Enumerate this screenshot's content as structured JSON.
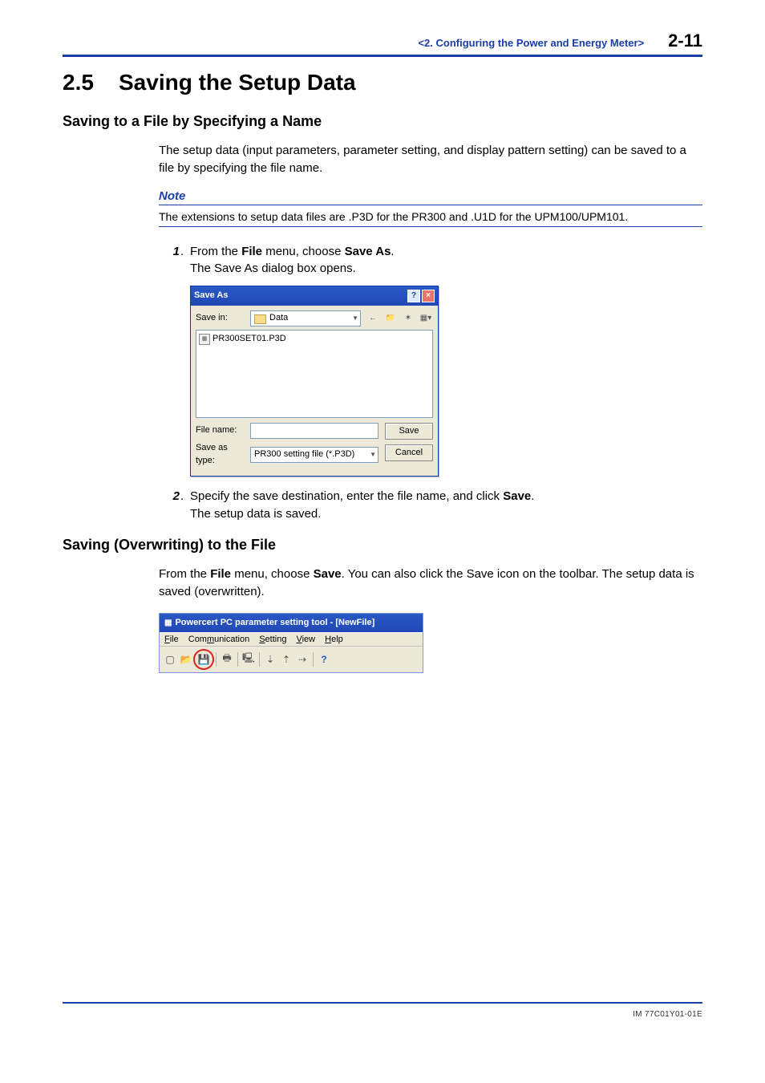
{
  "header": {
    "chapter": "<2.  Configuring the Power and Energy Meter>",
    "page": "2-11"
  },
  "section": {
    "number": "2.5",
    "title": "Saving the Setup Data"
  },
  "sub1": {
    "title": "Saving to a File by Specifying a Name",
    "intro": "The setup data (input parameters, parameter setting, and display pattern setting) can be saved to a file by specifying the file name.",
    "note_label": "Note",
    "note_body": "The extensions to setup data files are .P3D for the PR300 and .U1D for the UPM100/UPM101.",
    "step1_pre": "From the ",
    "step1_b1": "File",
    "step1_mid": " menu, choose ",
    "step1_b2": "Save As",
    "step1_post": ".",
    "step1_sub": "The Save As dialog box opens.",
    "step2_pre": "Specify the save destination, enter the file name, and click ",
    "step2_b1": "Save",
    "step2_post": ".",
    "step2_sub": "The setup data is saved."
  },
  "dialog": {
    "title": "Save As",
    "savein_label": "Save in:",
    "savein_value": "Data",
    "file_item": "PR300SET01.P3D",
    "filename_label": "File name:",
    "filename_value": "",
    "type_label": "Save as type:",
    "type_value": "PR300 setting file (*.P3D)",
    "save_btn": "Save",
    "cancel_btn": "Cancel"
  },
  "sub2": {
    "title": "Saving (Overwriting) to the File",
    "line_pre": "From the ",
    "line_b1": "File",
    "line_mid": " menu, choose ",
    "line_b2": "Save",
    "line_post": ".  You can also click the Save icon on the toolbar.  The setup data is saved (overwritten)."
  },
  "app": {
    "title": "Powercert PC parameter setting tool - [NewFile]",
    "menu": {
      "file": "File",
      "comm": "Communication",
      "setting": "Setting",
      "view": "View",
      "help": "Help"
    }
  },
  "footer": {
    "docid": "IM 77C01Y01-01E"
  }
}
